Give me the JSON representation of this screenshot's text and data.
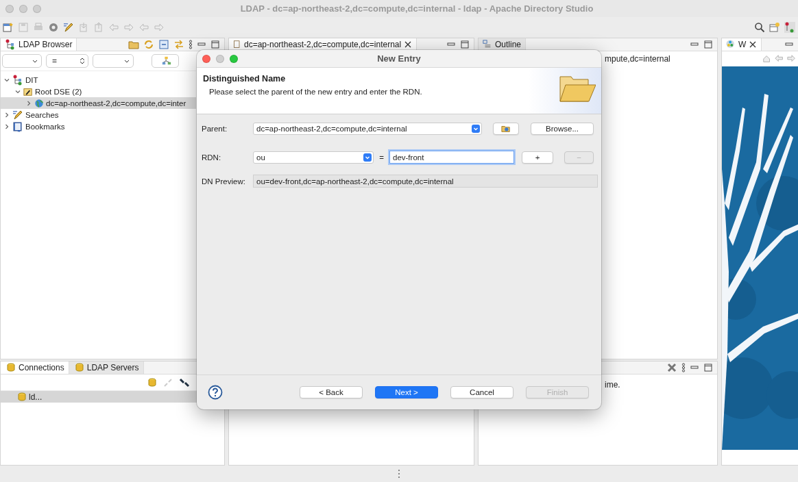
{
  "window": {
    "title": "LDAP - dc=ap-northeast-2,dc=compute,dc=internal - ldap - Apache Directory Studio"
  },
  "ldap_browser": {
    "tab": "LDAP Browser",
    "filter": {
      "operator": "="
    },
    "tree": [
      {
        "kind": "dit",
        "label": "DIT",
        "expanded": true,
        "selected": false,
        "children": [
          {
            "kind": "root",
            "label": "Root DSE (2)",
            "expanded": true,
            "selected": false,
            "children": [
              {
                "kind": "entry",
                "label": "dc=ap-northeast-2,dc=compute,dc=inter",
                "expanded": false,
                "selected": true
              }
            ]
          }
        ]
      },
      {
        "kind": "searches",
        "label": "Searches",
        "expanded": false,
        "selected": false
      },
      {
        "kind": "bookmarks",
        "label": "Bookmarks",
        "expanded": false,
        "selected": false
      }
    ]
  },
  "connections": {
    "tabs": [
      {
        "label": "Connections",
        "selected": true
      },
      {
        "label": "LDAP Servers",
        "selected": false
      }
    ],
    "items": [
      {
        "label": "ld...",
        "selected": true
      }
    ]
  },
  "editor": {
    "tab": "dc=ap-northeast-2,dc=compute,dc=internal"
  },
  "outline": {
    "tab": "Outline",
    "text": "mpute,dc=internal"
  },
  "properties": {
    "text": "ime."
  },
  "welcome": {
    "tab": "W"
  },
  "dialog": {
    "title": "New Entry",
    "heading": "Distinguished Name",
    "description": "Please select the parent of the new entry and enter the RDN.",
    "parent": {
      "label": "Parent:",
      "value": "dc=ap-northeast-2,dc=compute,dc=internal",
      "browse": "Browse..."
    },
    "rdn": {
      "label": "RDN:",
      "attribute": "ou",
      "equals": "=",
      "value": "dev-front",
      "focused": true,
      "add": "+",
      "remove": "−",
      "remove_disabled": true
    },
    "preview": {
      "label": "DN Preview:",
      "value": "ou=dev-front,dc=ap-northeast-2,dc=compute,dc=internal"
    },
    "buttons": [
      {
        "label": "< Back",
        "default": false,
        "disabled": false
      },
      {
        "label": "Next >",
        "default": true,
        "disabled": false
      },
      {
        "label": "Cancel",
        "default": false,
        "disabled": false
      },
      {
        "label": "Finish",
        "default": false,
        "disabled": true
      }
    ]
  }
}
